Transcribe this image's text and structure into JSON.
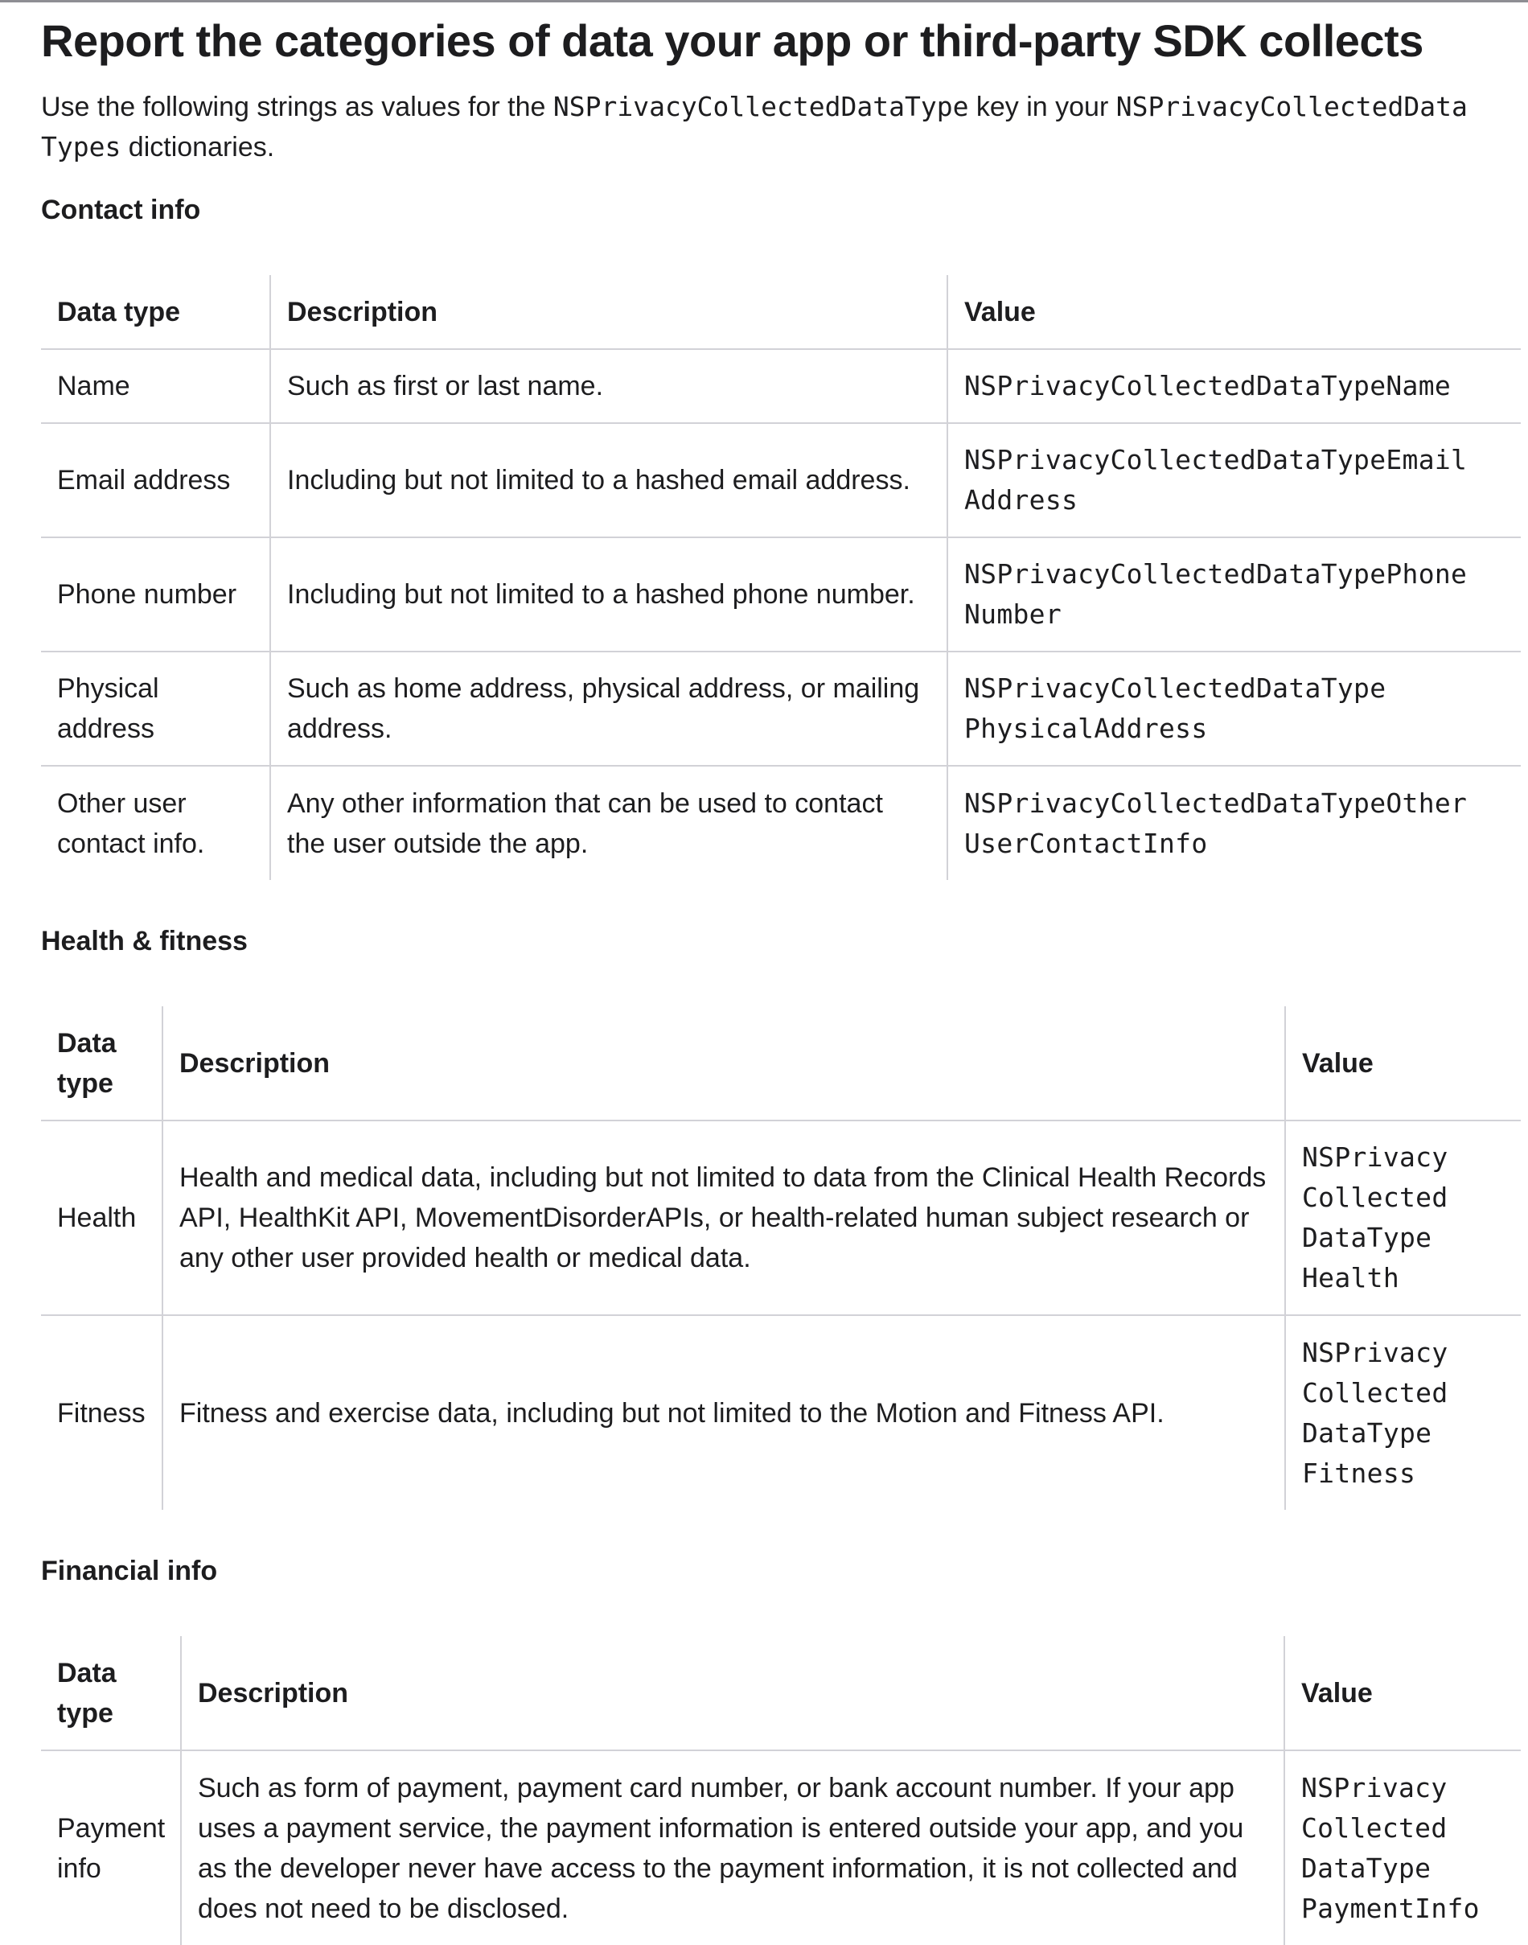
{
  "page": {
    "title": "Report the categories of data your app or third-party SDK collects",
    "intro": {
      "before": "Use the following strings as values for the ",
      "key": "NSPrivacyCollectedDataType",
      "middle": " key in your ",
      "dict_a": "NSPrivacyCollectedData",
      "dict_b": "Types",
      "after": " dictionaries."
    }
  },
  "contact": {
    "heading": "Contact info",
    "headers": [
      "Data type",
      "Description",
      "Value"
    ],
    "rows": [
      {
        "type": "Name",
        "desc": "Such as first or last name.",
        "value_lines": [
          "NSPrivacyCollectedDataTypeName"
        ]
      },
      {
        "type": "Email address",
        "desc": "Including but not limited to a hashed email address.",
        "value_lines": [
          "NSPrivacyCollectedDataTypeEmail",
          "Address"
        ]
      },
      {
        "type": "Phone number",
        "desc": "Including but not limited to a hashed phone number.",
        "value_lines": [
          "NSPrivacyCollectedDataTypePhone",
          "Number"
        ]
      },
      {
        "type_lines": [
          "Physical",
          "address"
        ],
        "desc_lines": [
          "Such as home address, physical address, or mailing",
          "address."
        ],
        "value_lines": [
          "NSPrivacyCollectedDataType",
          "PhysicalAddress"
        ]
      },
      {
        "type_lines": [
          "Other user",
          "contact info."
        ],
        "desc_lines": [
          "Any other information that can be used to contact",
          "the user outside the app."
        ],
        "value_lines": [
          "NSPrivacyCollectedDataTypeOther",
          "UserContactInfo"
        ]
      }
    ]
  },
  "health": {
    "heading": "Health & fitness",
    "headers": [
      "Data type",
      "Description",
      "Value"
    ],
    "rows": [
      {
        "type": "Health",
        "desc": "Health and medical data, including but not limited to data from the Clinical Health Records API, HealthKit API, MovementDisorderAPIs, or health-related human subject research or any other user provided health or medical data.",
        "value_lines": [
          "NSPrivacy",
          "Collected",
          "DataType",
          "Health"
        ]
      },
      {
        "type": "Fitness",
        "desc": "Fitness and exercise data, including but not limited to the Motion and Fitness API.",
        "value_lines": [
          "NSPrivacy",
          "Collected",
          "DataType",
          "Fitness"
        ]
      }
    ]
  },
  "financial": {
    "heading": "Financial info",
    "headers": [
      "Data type",
      "Description",
      "Value"
    ],
    "rows": [
      {
        "type_lines": [
          "Payment",
          "info"
        ],
        "desc": "Such as form of payment, payment card number, or bank account number. If your app uses a payment service, the payment information is entered outside your app, and you as the developer never have access to the payment information, it is not collected and does not need to be disclosed.",
        "value_lines": [
          "NSPrivacy",
          "Collected",
          "DataType",
          "PaymentInfo"
        ]
      }
    ]
  }
}
